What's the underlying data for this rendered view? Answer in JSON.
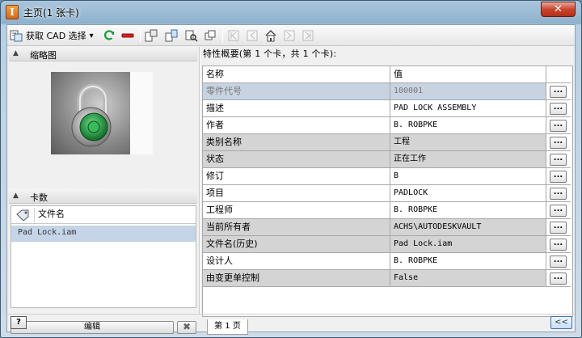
{
  "window": {
    "title": "主页(1 张卡)",
    "close_label": "✕"
  },
  "toolbar": {
    "fetch_label": "获取 CAD 选择",
    "dropdown_caret": "▾"
  },
  "left": {
    "thumbnail_header": "缩略图",
    "cards_header": "卡数",
    "file_column": "文件名",
    "files": [
      "Pad Lock.iam"
    ],
    "edit_label": "编辑",
    "clear_label": "✖"
  },
  "summary": "特性概要(第 1 个卡，共 1 个卡):",
  "grid": {
    "col_name": "名称",
    "col_value": "值",
    "more_label": "...",
    "rows": [
      {
        "name": "零件代号",
        "value": "100001"
      },
      {
        "name": "描述",
        "value": "PAD LOCK ASSEMBLY"
      },
      {
        "name": "作者",
        "value": "B. ROBPKE"
      },
      {
        "name": "类别名称",
        "value": "工程"
      },
      {
        "name": "状态",
        "value": "正在工作"
      },
      {
        "name": "修订",
        "value": "B"
      },
      {
        "name": "项目",
        "value": "PADLOCK"
      },
      {
        "name": "工程师",
        "value": "B. ROBPKE"
      },
      {
        "name": "当前所有者",
        "value": "ACHS\\AUTODESKVAULT"
      },
      {
        "name": "文件名(历史)",
        "value": "Pad Lock.iam"
      },
      {
        "name": "设计人",
        "value": "B. ROBPKE"
      },
      {
        "name": "由变更单控制",
        "value": "False"
      }
    ]
  },
  "page_tab": "第 1 页",
  "status": {
    "help_label": "?",
    "collapse_label": "<<"
  },
  "colors": {
    "accent_green": "#1c9a3a",
    "selected_row": "#c8d3e2",
    "gray_row": "#d4d4d4"
  }
}
